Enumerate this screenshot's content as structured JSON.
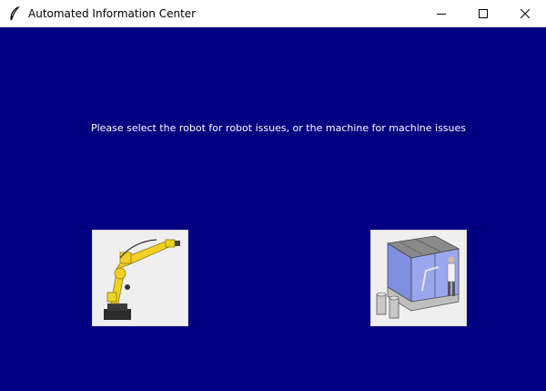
{
  "window": {
    "title": "Automated Information Center",
    "icons": [
      "feather-icon",
      "minimize-icon",
      "maximize-icon",
      "close-icon"
    ]
  },
  "main": {
    "prompt": "Please select the robot for robot issues, or the machine for machine issues",
    "buttons": [
      {
        "name": "robot-button",
        "icon": "robot-arm-icon"
      },
      {
        "name": "machine-button",
        "icon": "machine-cell-icon"
      }
    ]
  },
  "colors": {
    "background": "#000080",
    "titlebar": "#ffffff",
    "text": "#ffffff",
    "robot": "#f2d023"
  }
}
